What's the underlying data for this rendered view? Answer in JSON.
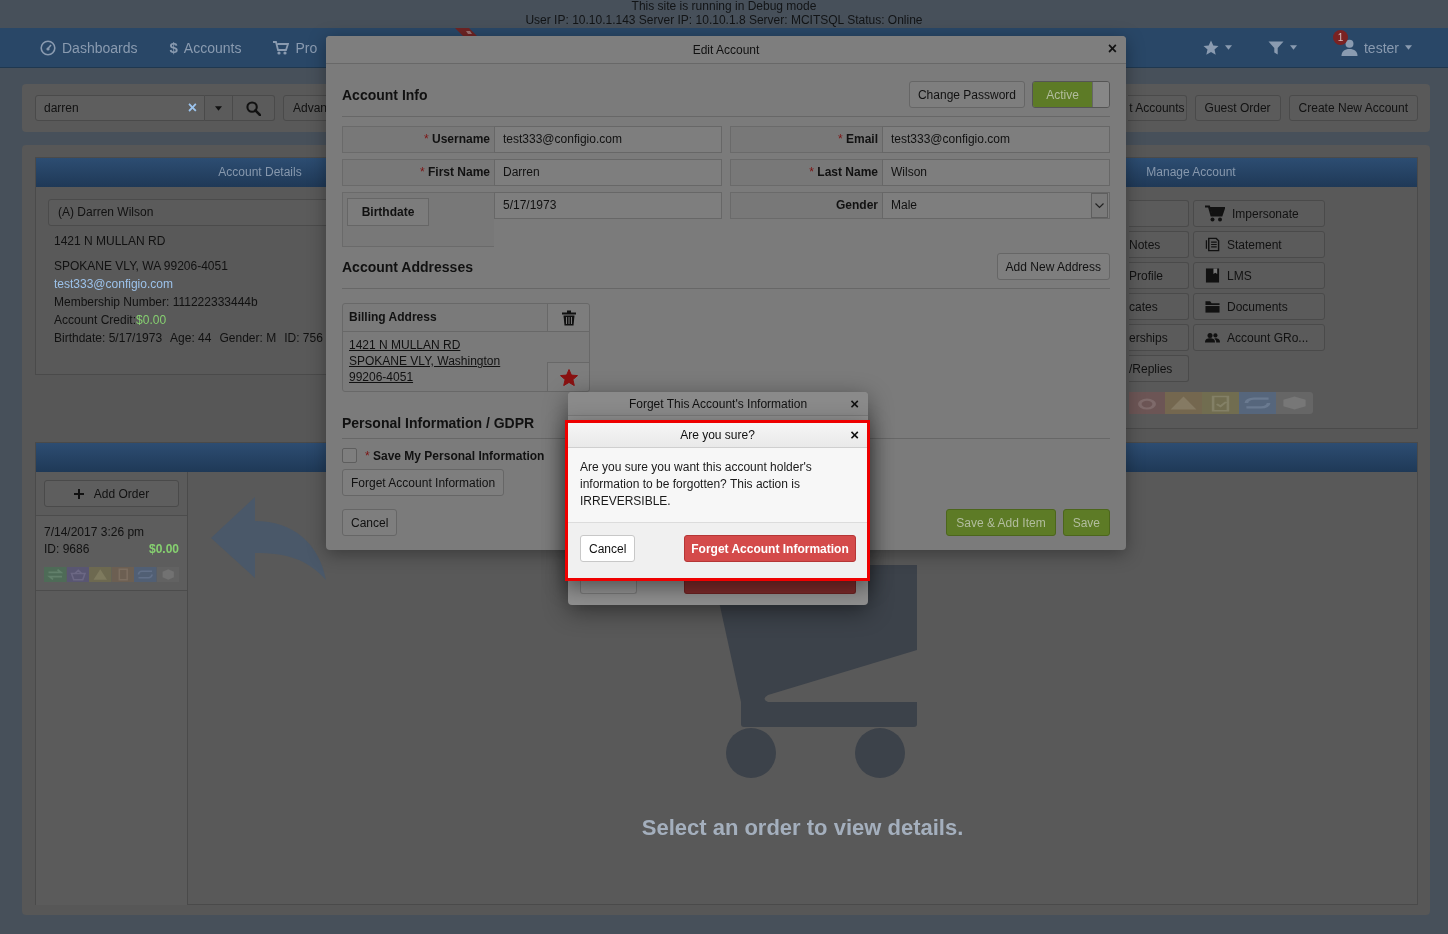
{
  "debug_banner": {
    "lines": [
      "This site is running in Debug mode",
      "User IP: 10.10.1.143 Server IP: 10.10.1.8 Server: MCITSQL Status: Online"
    ]
  },
  "nav": {
    "items": [
      {
        "label": "Dashboards"
      },
      {
        "symbol": "$",
        "label": "Accounts"
      },
      {
        "label": "Pro"
      }
    ],
    "notifications": "1",
    "user": "tester"
  },
  "toolbar": {
    "search_value": "darren",
    "clear": "×",
    "advanced": "Advan",
    "buttons": [
      "t Accounts",
      "Guest Order",
      "Create New Account"
    ]
  },
  "account_details": {
    "title": "Account Details",
    "name": "(A) Darren Wilson",
    "address_line_1": "1421 N MULLAN RD",
    "address_line_2": "SPOKANE VLY, WA 99206-4051",
    "email": "test333@configio.com",
    "membership": "Membership Number: 111222333444b",
    "credit_label": "Account Credit:",
    "credit_value": "$0.00",
    "facts": [
      "Birthdate: 5/17/1973",
      "Age: 44",
      "Gender: M",
      "ID: 756"
    ]
  },
  "manage_account": {
    "title": "Manage Account",
    "actions_left": [
      {
        "kind": "blank"
      },
      {
        "kind": "label",
        "label": "Notes"
      },
      {
        "kind": "label",
        "label": "Profile"
      },
      {
        "kind": "label",
        "label": "cates"
      },
      {
        "kind": "label",
        "label": "erships"
      },
      {
        "kind": "label",
        "label": "/Replies"
      }
    ],
    "actions_right": [
      {
        "label": "Impersonate"
      },
      {
        "label": "Statement"
      },
      {
        "label": "LMS"
      },
      {
        "label": "Documents"
      },
      {
        "label": "Account GRo..."
      }
    ]
  },
  "orders": {
    "add_button": "Add Order",
    "items": [
      {
        "date": "7/14/2017 3:26 pm",
        "id": "ID: 9686",
        "total": "$0.00"
      }
    ],
    "empty_message": "Select an order to view details."
  },
  "edit_account": {
    "title": "Edit Account",
    "close": "×",
    "account_info": {
      "heading": "Account Info",
      "change_password": "Change Password",
      "status": {
        "label": "Active",
        "on": true
      }
    },
    "fields": [
      {
        "kind": "text",
        "mark": "*",
        "label": "Username",
        "value": "test333@configio.com"
      },
      {
        "kind": "text",
        "mark": "*",
        "label": "Email",
        "value": "test333@configio.com"
      },
      {
        "kind": "text",
        "mark": "*",
        "label": "First Name",
        "value": "Darren"
      },
      {
        "kind": "text",
        "mark": "*",
        "label": "Last Name",
        "value": "Wilson"
      },
      {
        "kind": "date",
        "label": "Birthdate",
        "value": "5/17/1973"
      },
      {
        "kind": "select",
        "label": "Gender",
        "value": "Male"
      }
    ],
    "addresses": {
      "heading": "Account Addresses",
      "add_button": "Add New Address",
      "cards": [
        {
          "title": "Billing Address",
          "lines": [
            "1421 N MULLAN RD",
            "SPOKANE VLY, Washington",
            "99206-4051"
          ],
          "default": true
        }
      ]
    },
    "gdpr": {
      "heading": "Personal Information / GDPR",
      "consent": {
        "mark": "*",
        "label": "Save My Personal Information",
        "checked": false
      },
      "forget_button": "Forget Account Information"
    },
    "footer": {
      "cancel": "Cancel",
      "buttons": [
        "Save & Add Item",
        "Save"
      ]
    }
  },
  "forget_dialog": {
    "title": "Forget This Account's Information",
    "close": "×"
  },
  "confirm_dialog": {
    "title": "Are you sure?",
    "close": "×",
    "message": "Are you sure you want this account holder's information to be forgotten? This action is IRREVERSIBLE.",
    "cancel": "Cancel",
    "confirm": "Forget Account Information"
  }
}
